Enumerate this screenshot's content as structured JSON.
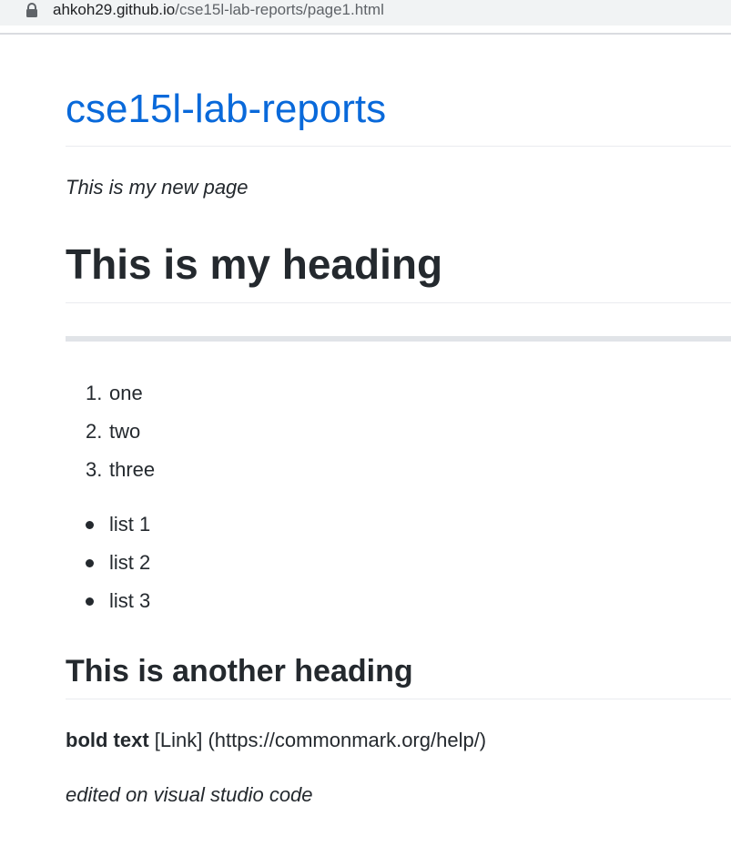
{
  "browser": {
    "url_host": "ahkoh29.github.io",
    "url_path": "/cse15l-lab-reports/page1.html",
    "lock_icon": "lock-icon"
  },
  "page": {
    "site_title": "cse15l-lab-reports",
    "intro": "This is my new page",
    "heading1": "This is my heading",
    "ordered_list": [
      {
        "marker": "1.",
        "text": "one"
      },
      {
        "marker": "2.",
        "text": "two"
      },
      {
        "marker": "3.",
        "text": "three"
      }
    ],
    "unordered_list": [
      "list 1",
      "list 2",
      "list 3"
    ],
    "heading2": "This is another heading",
    "bold_text": "bold text",
    "link_text": " [Link] (https://commonmark.org/help/)",
    "footer_note": "edited on visual studio code"
  },
  "colors": {
    "link": "#0969da",
    "text": "#24292e",
    "rule": "#eaecef"
  }
}
